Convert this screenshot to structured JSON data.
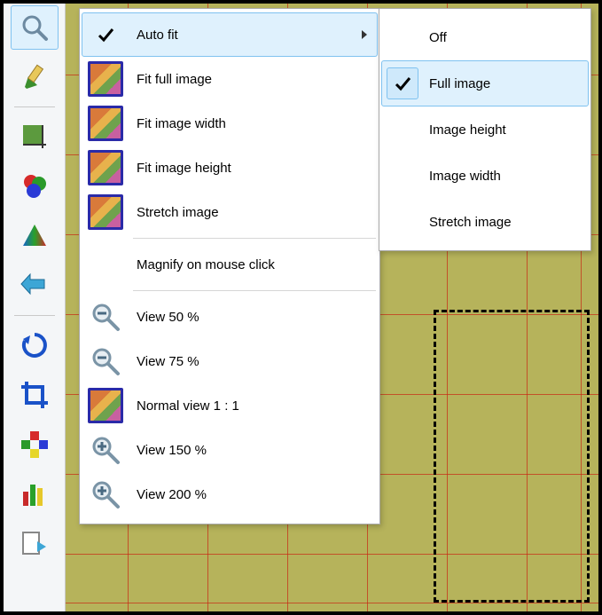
{
  "toolbar": {
    "tools": [
      {
        "name": "zoom-tool",
        "active": true
      },
      {
        "name": "pencil-tool"
      },
      {
        "name": "grid-measure-tool"
      },
      {
        "name": "rgb-circles-tool"
      },
      {
        "name": "cone-tool"
      },
      {
        "name": "back-arrow-tool"
      },
      {
        "name": "rotate-tool"
      },
      {
        "name": "crop-tool"
      },
      {
        "name": "color-swap-tool"
      },
      {
        "name": "histogram-tool"
      },
      {
        "name": "page-next-tool"
      }
    ],
    "separator_after": [
      1,
      5
    ]
  },
  "menu": {
    "auto_fit": {
      "label": "Auto fit",
      "has_submenu": true,
      "hover": true
    },
    "fit_full": {
      "label": "Fit full image"
    },
    "fit_width": {
      "label": "Fit image width"
    },
    "fit_height": {
      "label": "Fit image height"
    },
    "stretch": {
      "label": "Stretch image"
    },
    "magnify_click": {
      "label": "Magnify on mouse click"
    },
    "view_50": {
      "label": "View  50 %"
    },
    "view_75": {
      "label": "View  75 %"
    },
    "view_100": {
      "label": "Normal view  1 : 1"
    },
    "view_150": {
      "label": "View  150 %"
    },
    "view_200": {
      "label": "View  200 %"
    }
  },
  "submenu": {
    "off": {
      "label": "Off",
      "checked": false
    },
    "full_image": {
      "label": "Full image",
      "checked": true
    },
    "image_height": {
      "label": "Image height",
      "checked": false
    },
    "image_width": {
      "label": "Image width",
      "checked": false
    },
    "stretch_image": {
      "label": "Stretch image",
      "checked": false
    }
  }
}
